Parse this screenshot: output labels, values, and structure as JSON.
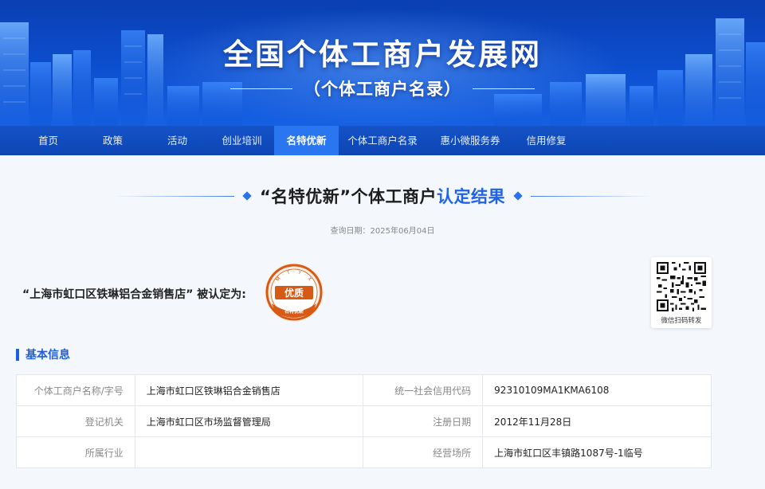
{
  "header": {
    "site_title": "全国个体工商户发展网",
    "site_subtitle": "（个体工商户名录）"
  },
  "nav": {
    "items": [
      {
        "label": "首页"
      },
      {
        "label": "政策"
      },
      {
        "label": "活动"
      },
      {
        "label": "创业培训"
      },
      {
        "label": "名特优新"
      },
      {
        "label": "个体工商户名录"
      },
      {
        "label": "惠小微服务券"
      },
      {
        "label": "信用修复"
      }
    ],
    "active_index": 4
  },
  "result": {
    "title_part1": "“名特优新”个体工商户",
    "title_part2": "认定结果",
    "query_date": "查询日期：2025年06月04日"
  },
  "certification": {
    "statement": "“上海市虹口区铁琳铝合金销售店” 被认定为:",
    "seal": {
      "arc_text": "M · T · Y · X",
      "center_text": "优质",
      "bottom_text": "名特优新",
      "color": "#d65a14"
    }
  },
  "qr": {
    "label": "微信扫码转发"
  },
  "basic_info": {
    "section_title": "基本信息",
    "rows": [
      {
        "k1": "个体工商户名称/字号",
        "v1": "上海市虹口区铁琳铝合金销售店",
        "k2": "统一社会信用代码",
        "v2": "92310109MA1KMA6108"
      },
      {
        "k1": "登记机关",
        "v1": "上海市虹口区市场监督管理局",
        "k2": "注册日期",
        "v2": "2012年11月28日"
      },
      {
        "k1": "所属行业",
        "v1": "",
        "k2": "经营场所",
        "v2": "上海市虹口区丰镇路1087号-1临号"
      }
    ]
  },
  "colors": {
    "brand_blue": "#1d5fe0",
    "nav_active": "#2a76f0",
    "seal_orange": "#d65a14"
  }
}
